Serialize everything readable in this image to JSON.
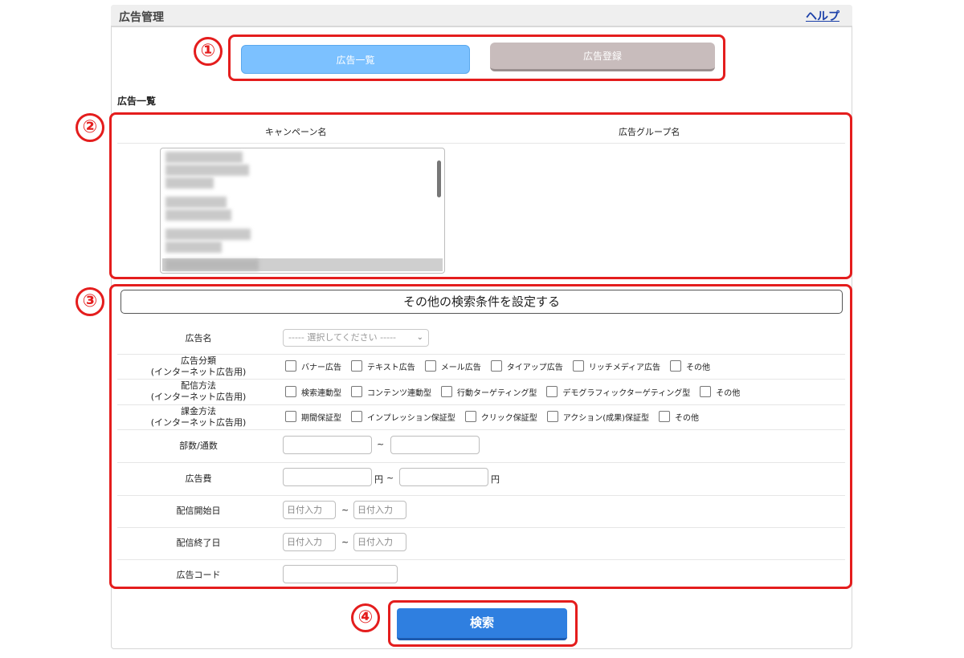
{
  "header": {
    "title": "広告管理",
    "help": "ヘルプ"
  },
  "callouts": [
    "①",
    "②",
    "③",
    "④"
  ],
  "tabs": {
    "list": "広告一覧",
    "register": "広告登録"
  },
  "section_title": "広告一覧",
  "columns": {
    "campaign": "キャンペーン名",
    "ad_group": "広告グループ名"
  },
  "more_conditions": "その他の検索条件を設定する",
  "fields": {
    "ad_name": {
      "label": "広告名",
      "placeholder": "----- 選択してください -----"
    },
    "ad_category": {
      "label1": "広告分類",
      "label2": "(インターネット広告用)",
      "options": [
        "バナー広告",
        "テキスト広告",
        "メール広告",
        "タイアップ広告",
        "リッチメディア広告",
        "その他"
      ]
    },
    "delivery": {
      "label1": "配信方法",
      "label2": "(インターネット広告用)",
      "options": [
        "検索連動型",
        "コンテンツ連動型",
        "行動ターゲティング型",
        "デモグラフィックターゲティング型",
        "その他"
      ]
    },
    "billing": {
      "label1": "課金方法",
      "label2": "(インターネット広告用)",
      "options": [
        "期間保証型",
        "インプレッション保証型",
        "クリック保証型",
        "アクション(成果)保証型",
        "その他"
      ]
    },
    "copies": {
      "label": "部数/通数",
      "sep": "~"
    },
    "cost": {
      "label": "広告費",
      "unit": "円",
      "sep": "~"
    },
    "start_date": {
      "label": "配信開始日",
      "placeholder": "日付入力",
      "sep": "~"
    },
    "end_date": {
      "label": "配信終了日",
      "placeholder": "日付入力",
      "sep": "~"
    },
    "ad_code": {
      "label": "広告コード"
    }
  },
  "search_button": "検索"
}
